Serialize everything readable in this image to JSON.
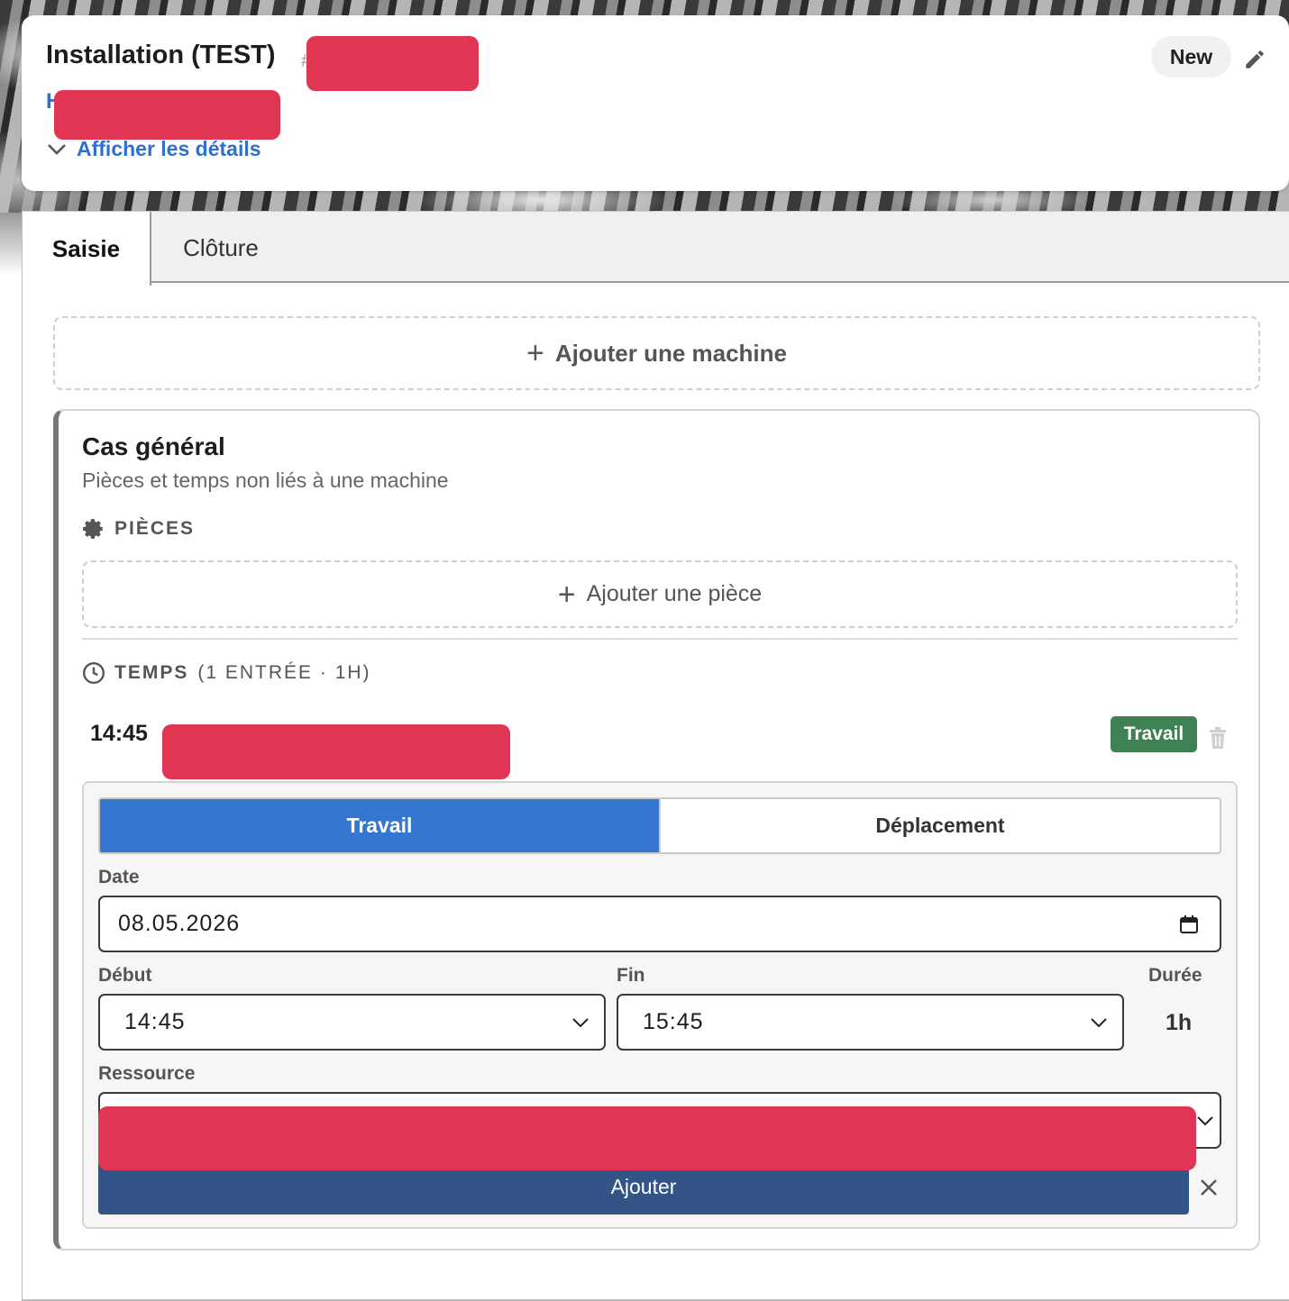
{
  "header": {
    "title": "Installation (TEST)",
    "hash": "#",
    "link_letter": "H",
    "details_toggle": "Afficher les détails",
    "status": "New"
  },
  "tabs": [
    {
      "label": "Saisie",
      "active": true
    },
    {
      "label": "Clôture",
      "active": false
    }
  ],
  "add_machine_label": "Ajouter une machine",
  "case": {
    "title": "Cas général",
    "subtitle": "Pièces et temps non liés à une machine",
    "pieces_label": "PIÈCES",
    "add_piece_label": "Ajouter une pièce",
    "temps_label": "TEMPS",
    "temps_meta": "(1 ENTRÉE · 1H)",
    "entry": {
      "time": "14:45",
      "badge": "Travail"
    }
  },
  "form": {
    "segment": [
      "Travail",
      "Déplacement"
    ],
    "date_label": "Date",
    "date_value": "08.05.2026",
    "debut_label": "Début",
    "debut_value": "14:45",
    "fin_label": "Fin",
    "fin_value": "15:45",
    "duree_label": "Durée",
    "duree_value": "1h",
    "ressource_label": "Ressource",
    "submit_label": "Ajouter"
  },
  "colors": {
    "link": "#2f6fd0",
    "segment_active": "#3576d0",
    "badge_travail": "#3e8152",
    "submit": "#325486",
    "redaction": "#e03654"
  }
}
